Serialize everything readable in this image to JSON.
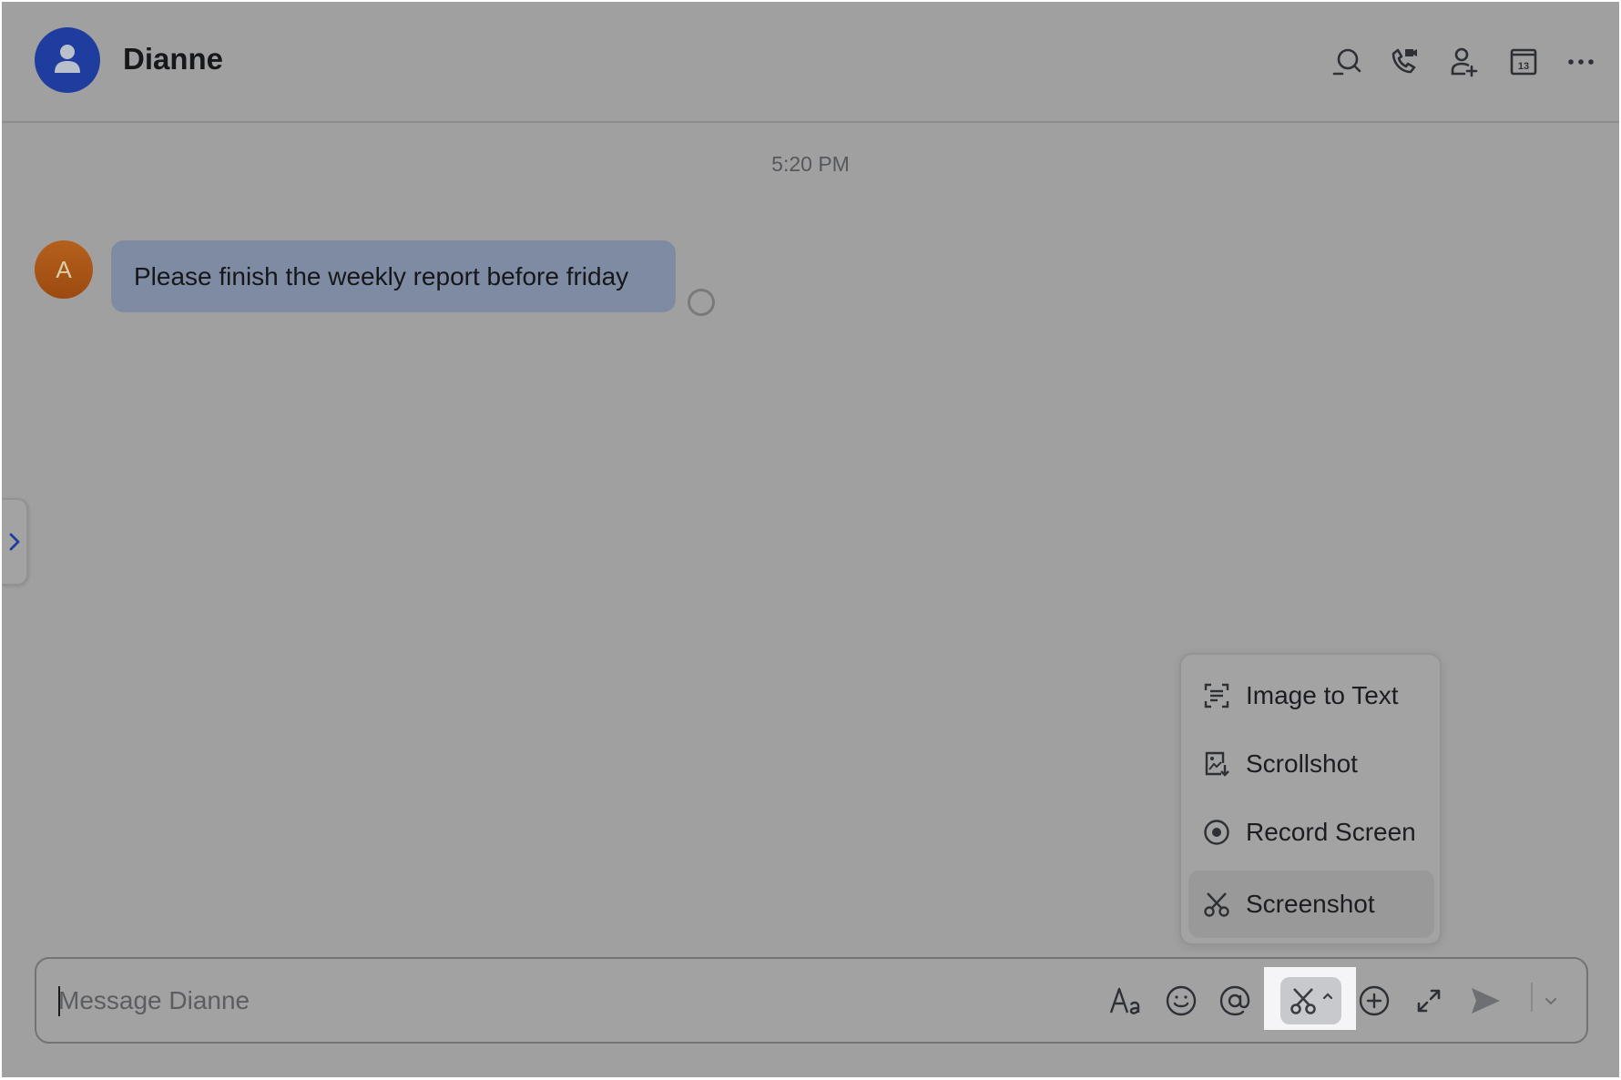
{
  "header": {
    "title": "Dianne",
    "avatar_icon": "person-icon",
    "actions": [
      {
        "name": "search-chat",
        "icon": "search-icon"
      },
      {
        "name": "call",
        "icon": "phone-video-icon"
      },
      {
        "name": "add-member",
        "icon": "add-user-icon"
      },
      {
        "name": "calendar",
        "icon": "calendar-icon",
        "text": "13"
      },
      {
        "name": "more",
        "icon": "more-icon"
      }
    ]
  },
  "chat": {
    "timestamp": "5:20 PM",
    "messages": [
      {
        "avatar_initial": "A",
        "text": "Please finish the weekly report before friday",
        "status": "unread"
      }
    ]
  },
  "capture_menu": {
    "items": [
      {
        "label": "Image to Text",
        "icon": "image-to-text-icon"
      },
      {
        "label": "Scrollshot",
        "icon": "scrollshot-icon"
      },
      {
        "label": "Record Screen",
        "icon": "record-icon"
      },
      {
        "label": "Screenshot",
        "icon": "scissors-icon",
        "active": true
      }
    ]
  },
  "composer": {
    "value": "",
    "placeholder": "Message Dianne",
    "tools": [
      {
        "name": "format",
        "icon": "text-format-icon"
      },
      {
        "name": "emoji",
        "icon": "emoji-icon"
      },
      {
        "name": "mention",
        "icon": "at-icon"
      },
      {
        "name": "screenshot",
        "icon": "scissors-icon"
      },
      {
        "name": "more-attachments",
        "icon": "plus-circle-icon"
      },
      {
        "name": "expand",
        "icon": "expand-icon"
      },
      {
        "name": "send",
        "icon": "send-icon"
      },
      {
        "name": "send-options",
        "icon": "chevron-down-icon"
      }
    ]
  },
  "colors": {
    "background": "#a0a0a0",
    "header_avatar": "#1f3d9e",
    "message_bubble": "#7f8ba3",
    "message_avatar": "#b5601c",
    "side_tab_chevron": "#1f3d9e"
  }
}
